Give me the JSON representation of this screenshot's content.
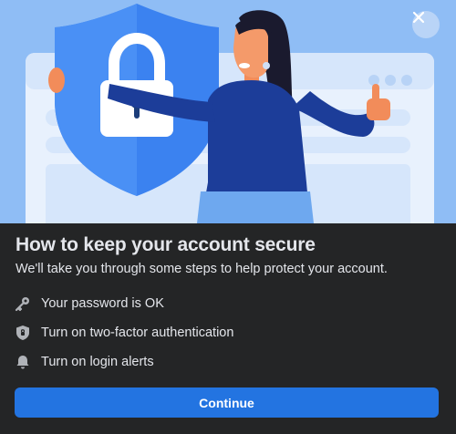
{
  "dialog": {
    "close_icon": "close-icon",
    "title": "How to keep your account secure",
    "subtitle": "We'll take you through some steps to help protect your account.",
    "steps": [
      {
        "icon": "key-icon",
        "label": "Your password is OK"
      },
      {
        "icon": "shield-icon",
        "label": "Turn on two-factor authentication"
      },
      {
        "icon": "bell-icon",
        "label": "Turn on login alerts"
      }
    ],
    "continue_label": "Continue"
  },
  "colors": {
    "hero_background": "#8fbdf5",
    "dialog_background": "#242526",
    "primary_button": "#2374e1",
    "text": "#e4e6eb",
    "icon": "#b0b3b8"
  }
}
